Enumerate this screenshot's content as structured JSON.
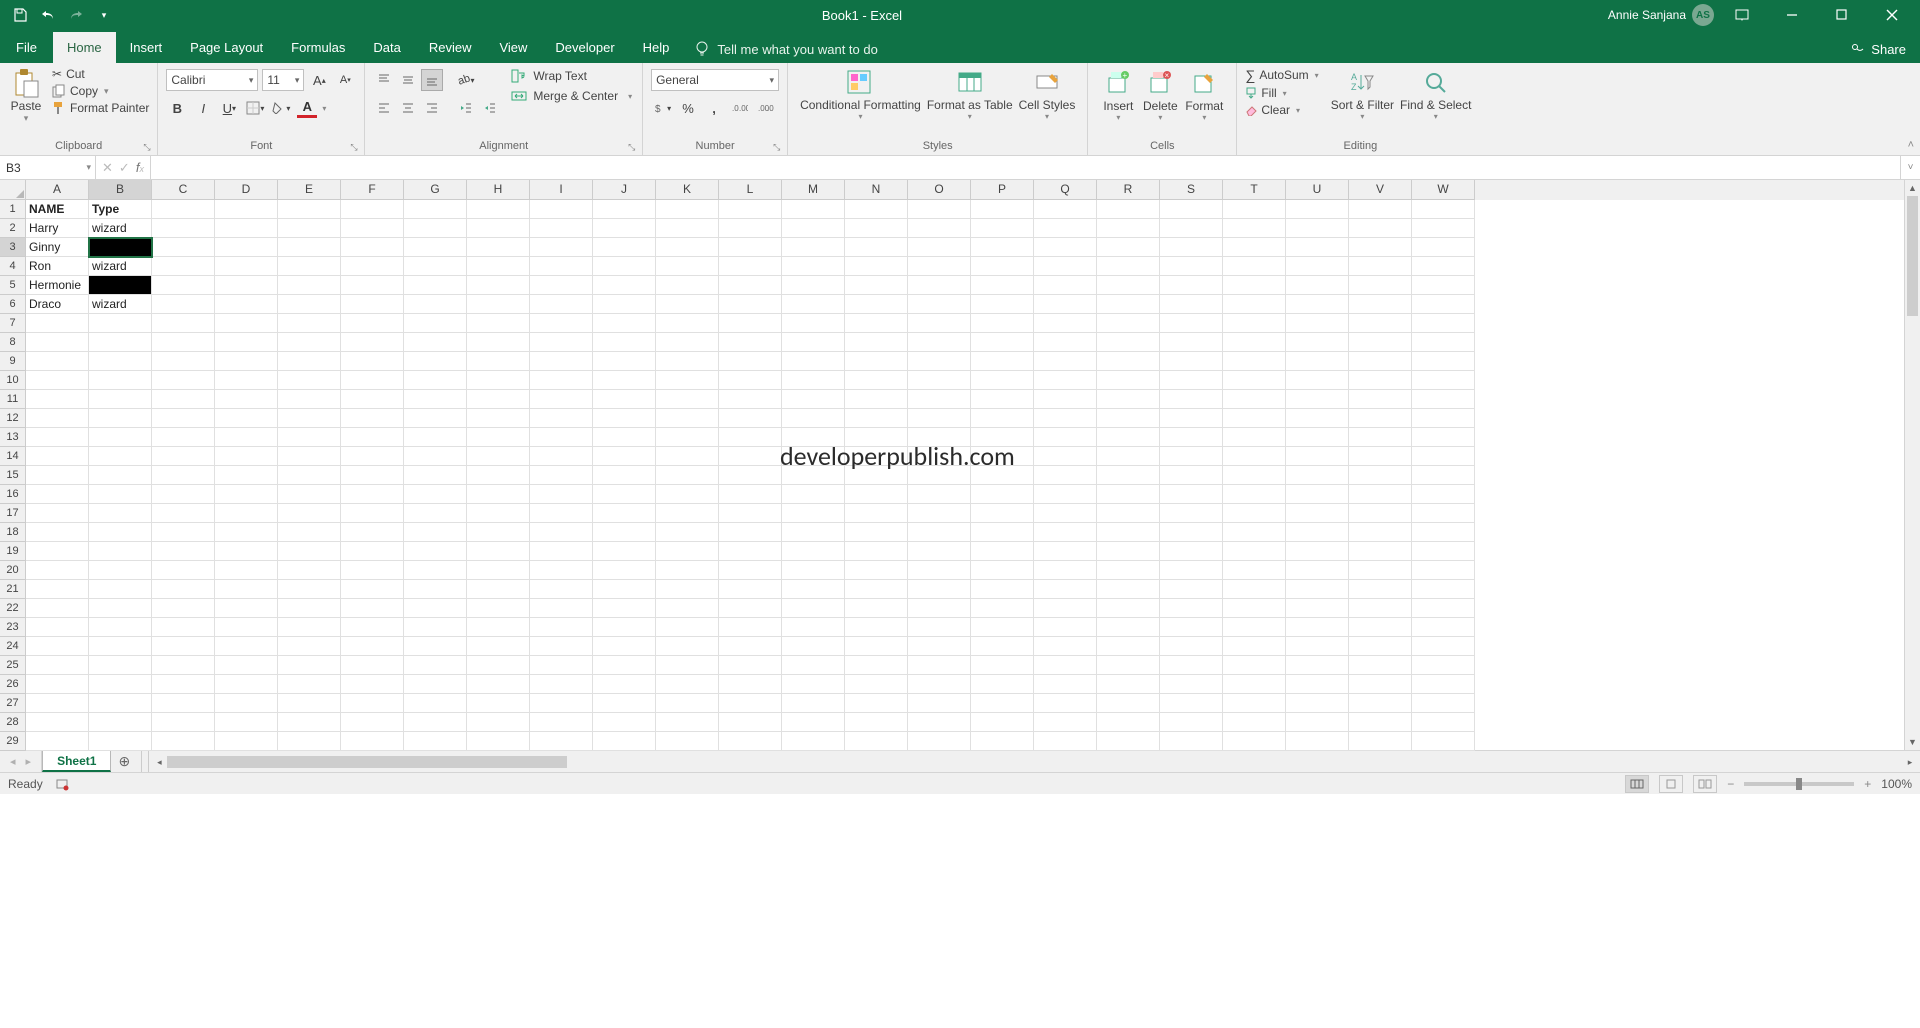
{
  "title": {
    "doc": "Book1",
    "sep": "  -  ",
    "app": "Excel"
  },
  "user": {
    "name": "Annie Sanjana",
    "initials": "AS"
  },
  "qat": [
    "save",
    "undo",
    "redo",
    "customize"
  ],
  "tabs": [
    "File",
    "Home",
    "Insert",
    "Page Layout",
    "Formulas",
    "Data",
    "Review",
    "View",
    "Developer",
    "Help"
  ],
  "active_tab": "Home",
  "tell_me": "Tell me what you want to do",
  "share": "Share",
  "ribbon": {
    "clipboard": {
      "paste": "Paste",
      "cut": "Cut",
      "copy": "Copy",
      "format_painter": "Format Painter",
      "label": "Clipboard"
    },
    "font": {
      "name": "Calibri",
      "size": "11",
      "label": "Font"
    },
    "alignment": {
      "wrap": "Wrap Text",
      "merge": "Merge & Center",
      "label": "Alignment"
    },
    "number": {
      "format": "General",
      "label": "Number"
    },
    "styles": {
      "cond": "Conditional Formatting",
      "table": "Format as Table",
      "cell": "Cell Styles",
      "label": "Styles"
    },
    "cells": {
      "insert": "Insert",
      "delete": "Delete",
      "format": "Format",
      "label": "Cells"
    },
    "editing": {
      "autosum": "AutoSum",
      "fill": "Fill",
      "clear": "Clear",
      "sort": "Sort & Filter",
      "find": "Find & Select",
      "label": "Editing"
    }
  },
  "name_box": "B3",
  "formula": "",
  "columns": [
    "A",
    "B",
    "C",
    "D",
    "E",
    "F",
    "G",
    "H",
    "I",
    "J",
    "K",
    "L",
    "M",
    "N",
    "O",
    "P",
    "Q",
    "R",
    "S",
    "T",
    "U",
    "V",
    "W"
  ],
  "rows": 29,
  "selected": {
    "row": 3,
    "col": "B"
  },
  "cells": {
    "A1": "NAME",
    "B1": "Type",
    "A2": "Harry",
    "B2": "wizard",
    "A3": "Ginny",
    "A4": "Ron",
    "B4": "wizard",
    "A5": "Hermonie",
    "A6": "Draco",
    "B6": "wizard"
  },
  "black_cells": [
    "B3",
    "B5"
  ],
  "bold_cells": [
    "A1",
    "B1"
  ],
  "watermark": "developerpublish.com",
  "sheet_tabs": [
    "Sheet1"
  ],
  "status": {
    "ready": "Ready",
    "zoom": "100%"
  }
}
